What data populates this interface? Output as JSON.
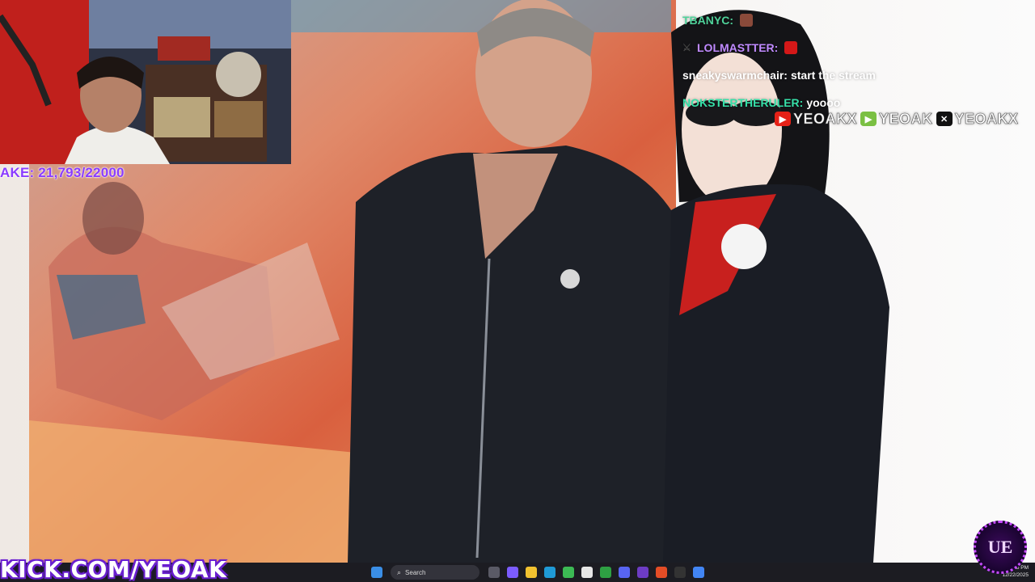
{
  "stream": {
    "goal_text": "AKE: 21,793/22000",
    "kick_banner": "KICK.COM/YEOAK",
    "badge_text": "UE"
  },
  "chat": {
    "messages": [
      {
        "user": "TBANYC:",
        "text": "",
        "user_color": "#4fd29a",
        "emote": "emote"
      },
      {
        "user": "LOLMASTTER:",
        "text": "",
        "user_color": "#c08aff",
        "emote": "flag-albania-icon"
      },
      {
        "user": "sneakyswarmchair:",
        "text": "start the stream",
        "user_color": "#ffffff"
      },
      {
        "user": "NOKSTERTHERULER:",
        "text": "yoooo",
        "user_color": "#36e0a8"
      }
    ]
  },
  "socials": [
    {
      "icon": "youtube-icon",
      "name": "YEOAKX",
      "color": "#e62117"
    },
    {
      "icon": "rumble-icon",
      "name": "YEOAK",
      "color": "#7bc043"
    },
    {
      "icon": "x-icon",
      "name": "YEOAKX",
      "color": "#111111"
    }
  ],
  "taskbar": {
    "search_placeholder": "Search",
    "time": "4:15 PM",
    "date": "12/22/2025"
  }
}
